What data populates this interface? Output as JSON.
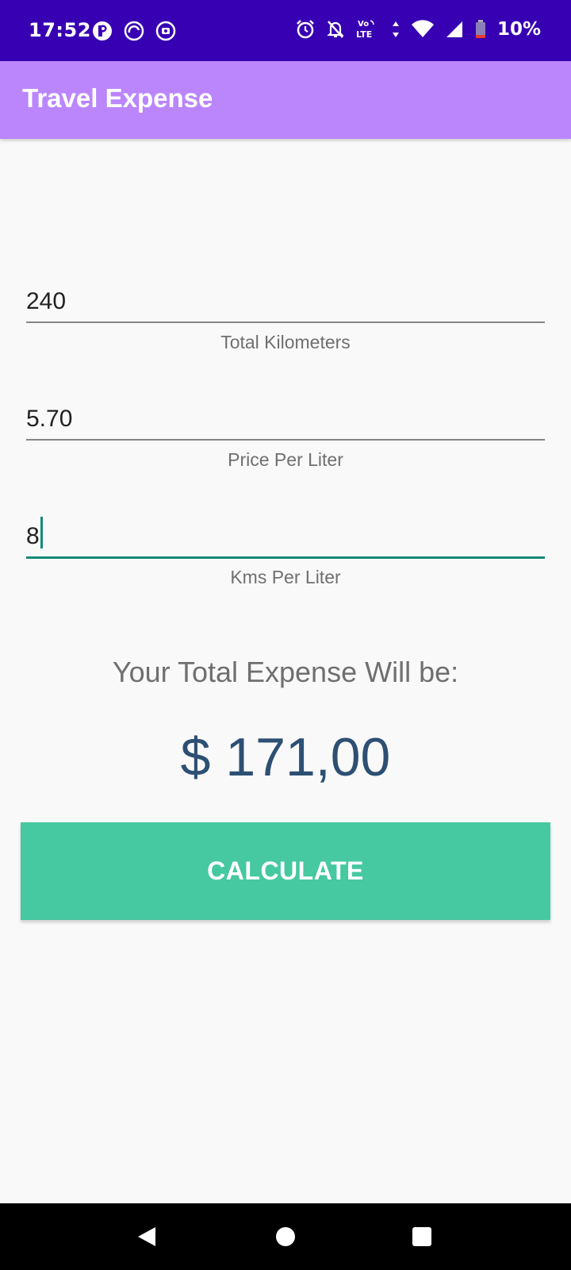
{
  "status_bar": {
    "time": "17:52",
    "battery_percent": "10%",
    "left_icons": [
      "app-notification-icon",
      "sync-icon",
      "record-icon"
    ],
    "right_icons": [
      "alarm-icon",
      "bell-off-icon",
      "volte-icon",
      "data-arrows-icon",
      "wifi-icon",
      "signal-icon",
      "battery-icon"
    ],
    "volte_label_top": "Vo",
    "volte_label_bottom": "LTE"
  },
  "app_bar": {
    "title": "Travel Expense",
    "color": "#bb86fc"
  },
  "form": {
    "fields": [
      {
        "value": "240",
        "label": "Total Kilometers"
      },
      {
        "value": "5.70",
        "label": "Price Per Liter"
      },
      {
        "value": "8",
        "label": "Kms Per Liter"
      }
    ]
  },
  "result": {
    "heading": "Your Total Expense Will be:",
    "value": "$ 171,00"
  },
  "calculate_button": {
    "label": "CALCULATE",
    "color": "#46c8a0"
  },
  "nav_bar": {
    "icons": [
      "back-icon",
      "home-icon",
      "recents-icon"
    ]
  }
}
